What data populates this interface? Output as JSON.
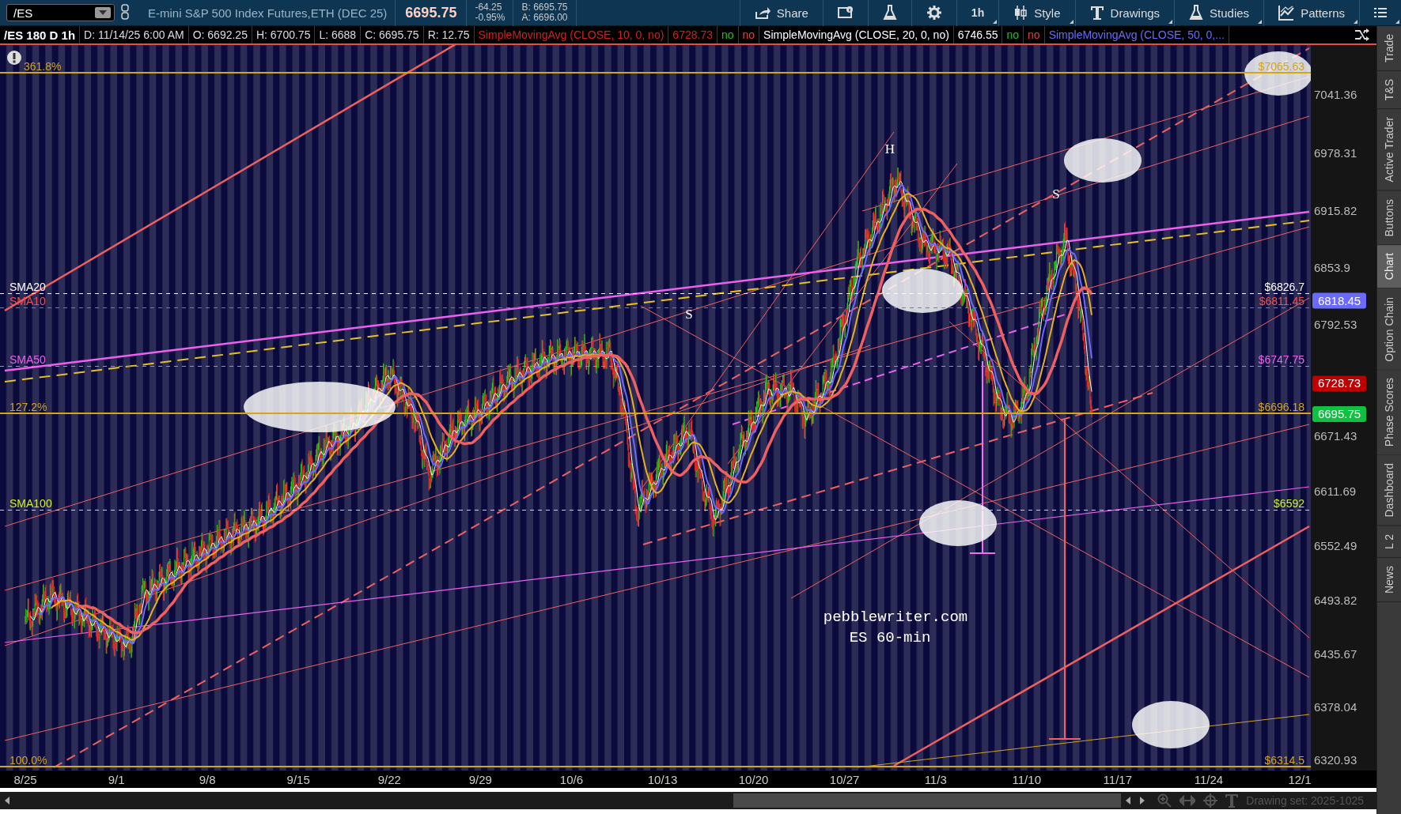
{
  "toolbar": {
    "symbol": "/ES",
    "description": "E-mini S&P 500 Index Futures,ETH (DEC 25)",
    "last_price": "6695.75",
    "change": "-64.25",
    "change_percent": "-0.95%",
    "bid": "B: 6695.75",
    "ask": "A: 6696.00",
    "buttons": [
      {
        "kind": "share",
        "label": "Share"
      },
      {
        "kind": "info"
      },
      {
        "kind": "flask"
      },
      {
        "kind": "gear"
      },
      {
        "kind": "text",
        "label": "1h"
      },
      {
        "kind": "style",
        "label": "Style"
      },
      {
        "kind": "drawings",
        "label": "Drawings"
      },
      {
        "kind": "studies",
        "label": "Studies"
      },
      {
        "kind": "patterns",
        "label": "Patterns"
      },
      {
        "kind": "menu"
      }
    ]
  },
  "study_bar": {
    "cells": [
      "/ES 180 D 1h",
      "D: 11/14/25 6:00 AM",
      "O: 6692.25",
      "H: 6700.75",
      "L: 6688",
      "C: 6695.75",
      "R: 12.75"
    ],
    "studies": [
      {
        "name": "SimpleMovingAvg (CLOSE, 10, 0, no)",
        "color": "#d02020",
        "value": "6728.73",
        "flags": [
          {
            "label": "no",
            "color": "#20c020"
          },
          {
            "label": "no",
            "color": "#e04040"
          }
        ]
      },
      {
        "name": "SimpleMovingAvg (CLOSE, 20, 0, no)",
        "color": "#ffffff",
        "value": "6746.55",
        "flags": [
          {
            "label": "no",
            "color": "#20c020"
          },
          {
            "label": "no",
            "color": "#e04040"
          }
        ]
      },
      {
        "name": "SimpleMovingAvg (CLOSE, 50, 0,...",
        "color": "#6a6aff"
      }
    ]
  },
  "chart": {
    "levels": [
      {
        "kind": "fib",
        "left_label": "361.8%",
        "right_label": "$7065.63",
        "color": "#d4a517"
      },
      {
        "kind": "sma",
        "left_label": "SMA20",
        "right_label": "$6826.7",
        "color": "#ffffff"
      },
      {
        "kind": "sma",
        "left_label": "SMA10",
        "right_label": "$6811.45",
        "color": "#f05050"
      },
      {
        "kind": "sma",
        "left_label": "SMA50",
        "right_label": "$6747.75",
        "color": "#f060f0"
      },
      {
        "kind": "fib",
        "left_label": "127.2%",
        "right_label": "$6696.18",
        "color": "#d4a517"
      },
      {
        "kind": "sma",
        "left_label": "SMA100",
        "right_label": "$6592",
        "color": "#d0f020"
      },
      {
        "kind": "fib",
        "left_label": "100.0%",
        "right_label": "$6314.5",
        "color": "#d4a517"
      }
    ],
    "price_axis": [
      "7041.36",
      "6978.31",
      "6915.82",
      "6853.9",
      "6792.53",
      "6671.43",
      "6611.69",
      "6552.49",
      "6493.82",
      "6435.67",
      "6378.04",
      "6320.93"
    ],
    "price_badges": [
      {
        "label": "6818.45",
        "color": "#6a6aff"
      },
      {
        "label": "6728.73",
        "color": "#c00000"
      },
      {
        "label": "6695.75",
        "color": "#10c040"
      }
    ],
    "annotations": [
      "H",
      "S",
      "S"
    ],
    "caption": [
      "pebblewriter.com",
      "ES 60-min"
    ],
    "date_axis": [
      "8/25",
      "9/1",
      "9/8",
      "9/15",
      "9/22",
      "9/29",
      "10/6",
      "10/13",
      "10/20",
      "10/27",
      "11/3",
      "11/10",
      "11/17",
      "11/24",
      "12/1"
    ]
  },
  "side_tabs": [
    {
      "label": "Trade",
      "selected": false
    },
    {
      "label": "T&S",
      "selected": false
    },
    {
      "label": "Active Trader",
      "selected": false
    },
    {
      "label": "Buttons",
      "selected": false
    },
    {
      "label": "Chart",
      "selected": true
    },
    {
      "label": "Option Chain",
      "selected": false
    },
    {
      "label": "Phase Scores",
      "selected": false
    },
    {
      "label": "Dashboard",
      "selected": false
    },
    {
      "label": "L 2",
      "selected": false
    },
    {
      "label": "News",
      "selected": false
    }
  ],
  "bottom_bar": {
    "drawing_set": "Drawing set: 2025-1025"
  }
}
